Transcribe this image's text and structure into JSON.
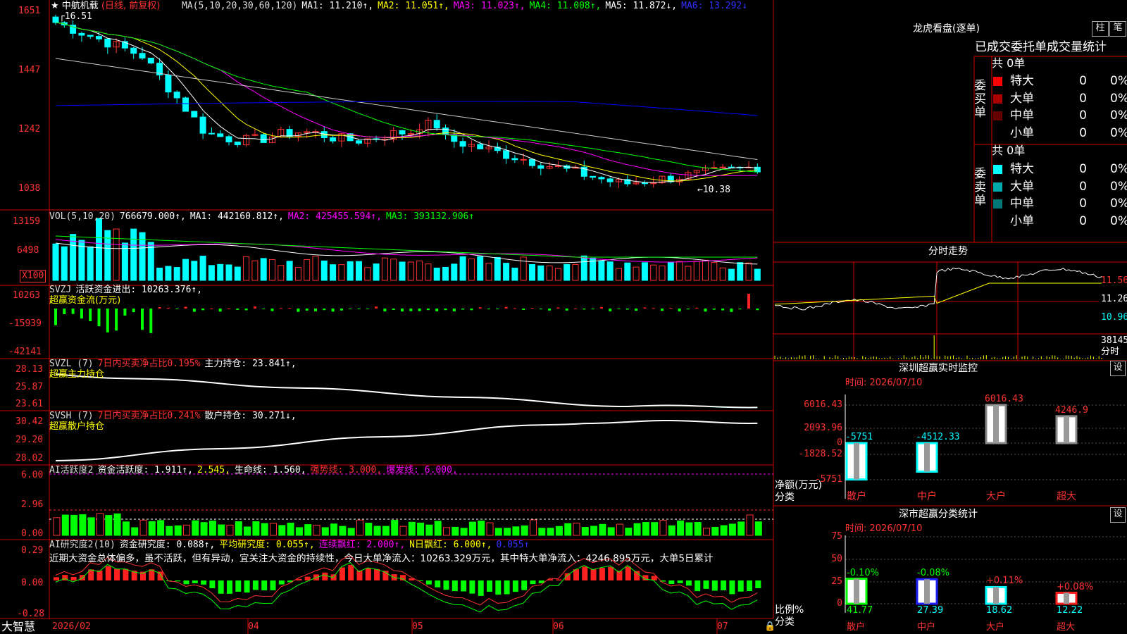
{
  "colors": {
    "up": "#ff3232",
    "down": "#00ffff",
    "panel_border": "#d00000",
    "ma1": "#ffffff",
    "ma2": "#ffff00",
    "ma3": "#ff00ff",
    "ma4": "#00ff00",
    "ma5": "#ffffff",
    "ma6": "#0000ff"
  },
  "main": {
    "stock_name": "中航机载",
    "period": "(日线, 前复权)",
    "ma_legend": [
      {
        "text": "MA(5,10,20,30,60,120)",
        "color": "#dddddd"
      },
      {
        "text": "MA1: 11.210↑,",
        "color": "#ffffff"
      },
      {
        "text": "MA2: 11.051↑,",
        "color": "#ffff00"
      },
      {
        "text": "MA3: 11.023↑,",
        "color": "#ff00ff"
      },
      {
        "text": "MA4: 11.008↑,",
        "color": "#00ff00"
      },
      {
        "text": "MA5: 11.872↓,",
        "color": "#ffffff"
      },
      {
        "text": "MA6: 13.292↓",
        "color": "#3030ff"
      }
    ],
    "y_ticks": [
      "1651",
      "1447",
      "1242",
      "1038"
    ],
    "high_mark": "16.51",
    "low_mark": "10.38"
  },
  "vol": {
    "legend": [
      {
        "text": "VOL(5,10,20)",
        "color": "#dddddd"
      },
      {
        "text": "766679.000↑,",
        "color": "#ffffff"
      },
      {
        "text": "MA1: 442160.812↑,",
        "color": "#ffffff"
      },
      {
        "text": "MA2: 425455.594↑,",
        "color": "#ff00ff"
      },
      {
        "text": "MA3: 393132.906↑",
        "color": "#00ff00"
      }
    ],
    "y_ticks": [
      "13159",
      "6498"
    ],
    "unit": "X100"
  },
  "svzj": {
    "legend": [
      {
        "text": "SVZJ",
        "color": "#dddddd"
      },
      {
        "text": "活跃资金进出: 10263.376↑,",
        "color": "#ffffff"
      }
    ],
    "subtitle": "超赢资金流(万元)",
    "y_ticks": [
      "10263",
      "-15939",
      "-42141"
    ]
  },
  "svzl": {
    "legend": [
      {
        "text": "SVZL (7)",
        "color": "#dddddd"
      },
      {
        "text": "7日内买卖净占比0.195%",
        "color": "#ff3232"
      },
      {
        "text": "主力持仓: 23.841↑,",
        "color": "#ffffff"
      }
    ],
    "subtitle": "超赢主力持仓",
    "y_ticks": [
      "28.13",
      "25.87",
      "23.61"
    ]
  },
  "svsh": {
    "legend": [
      {
        "text": "SVSH (7)",
        "color": "#dddddd"
      },
      {
        "text": "7日内买卖净占比0.241%",
        "color": "#ff3232"
      },
      {
        "text": "散户持仓: 30.271↓,",
        "color": "#ffffff"
      }
    ],
    "subtitle": "超赢散户持仓",
    "y_ticks": [
      "30.42",
      "29.20",
      "28.02"
    ]
  },
  "ai_active": {
    "legend": [
      {
        "text": "AI活跃度2",
        "color": "#dddddd"
      },
      {
        "text": "资金活跃度: 1.911↑,",
        "color": "#ffffff"
      },
      {
        "text": "2.545,",
        "color": "#ffff00"
      },
      {
        "text": "生命线: 1.560,",
        "color": "#ffffff"
      },
      {
        "text": "强势线: 3.000,",
        "color": "#ff3232"
      },
      {
        "text": "爆发线: 6.000,",
        "color": "#ff00ff"
      }
    ],
    "y_ticks": [
      "6.00",
      "2.96",
      "0.00"
    ]
  },
  "ai_research": {
    "legend": [
      {
        "text": "AI研究度2(10)",
        "color": "#dddddd"
      },
      {
        "text": "资金研究度: 0.088↑,",
        "color": "#ffffff"
      },
      {
        "text": "平均研究度: 0.055↑,",
        "color": "#ffff00"
      },
      {
        "text": "连续飘红: 2.000↑,",
        "color": "#ff00ff"
      },
      {
        "text": "N日飘红: 6.000↑,",
        "color": "#ffff00"
      },
      {
        "text": "0.055↑",
        "color": "#3030ff"
      }
    ],
    "commentary": "近期大资金总体偏多，虽不活跃，但有异动，宜关注大资金的持续性，今日大单净流入：10263.329万元，其中特大单净流入：4246.895万元，大单5日累计",
    "y_ticks": [
      "0.29",
      "0.00",
      "-0.28"
    ]
  },
  "x_axis": {
    "labels": [
      "2026/02",
      "04",
      "05",
      "06",
      "07"
    ]
  },
  "footer": {
    "brand": "大智慧"
  },
  "right": {
    "lhb": {
      "title": "龙虎看盘(逐单)",
      "btn_bar": "柱",
      "btn_pen": "笔",
      "tabs": "已成交委托单成交量统计",
      "buy": {
        "side_label": "委买单",
        "total": "共 0单",
        "rows": [
          {
            "label": "特大",
            "value": "0",
            "pct": "0%",
            "color": "#ff0000"
          },
          {
            "label": "大单",
            "value": "0",
            "pct": "0%",
            "color": "#aa0000"
          },
          {
            "label": "中单",
            "value": "0",
            "pct": "0%",
            "color": "#660000"
          },
          {
            "label": "小单",
            "value": "0",
            "pct": "0%",
            "color": ""
          }
        ]
      },
      "sell": {
        "side_label": "委卖单",
        "total": "共 0单",
        "rows": [
          {
            "label": "特大",
            "value": "0",
            "pct": "0%",
            "color": "#00ffff"
          },
          {
            "label": "大单",
            "value": "0",
            "pct": "0%",
            "color": "#00aaaa"
          },
          {
            "label": "中单",
            "value": "0",
            "pct": "0%",
            "color": "#007777"
          },
          {
            "label": "小单",
            "value": "0",
            "pct": "0%",
            "color": ""
          }
        ]
      }
    },
    "fenshi": {
      "title": "分时走势",
      "price_labels": [
        "11.56",
        "11.26",
        "10.96"
      ],
      "vol_label": "38145",
      "footer_label": "分时"
    },
    "realtime": {
      "title": "深圳超赢实时监控",
      "settings": "设",
      "time": "时间: 2026/07/10",
      "y_ticks": [
        "6016.43",
        "2093.96",
        "0",
        "-1828.52",
        "-5751"
      ],
      "y_name": "净额(万元)",
      "x_name": "分类",
      "bars": [
        {
          "cat": "散户",
          "value": -5751,
          "label": "-5751"
        },
        {
          "cat": "中户",
          "value": -4512.33,
          "label": "-4512.33"
        },
        {
          "cat": "大户",
          "value": 6016.43,
          "label": "6016.43"
        },
        {
          "cat": "超大",
          "value": 4246.9,
          "label": "4246.9"
        }
      ]
    },
    "classify": {
      "title": "深市超赢分类统计",
      "settings": "设",
      "time": "时间: 2026/07/10",
      "y_ticks": [
        "75",
        "50",
        "25",
        "0"
      ],
      "y_name": "比例%",
      "x_name": "分类",
      "bars": [
        {
          "cat": "散户",
          "value": 41.77,
          "label": "41.77",
          "change": "-0.10%",
          "color": "#00ff00"
        },
        {
          "cat": "中户",
          "value": 27.39,
          "label": "27.39",
          "change": "-0.08%",
          "color": "#2020ff"
        },
        {
          "cat": "大户",
          "value": 18.62,
          "label": "18.62",
          "change": "+0.11%",
          "color": "#00ffff"
        },
        {
          "cat": "超大",
          "value": 12.22,
          "label": "12.22",
          "change": "+0.08%",
          "color": "#ff2020"
        }
      ]
    }
  }
}
